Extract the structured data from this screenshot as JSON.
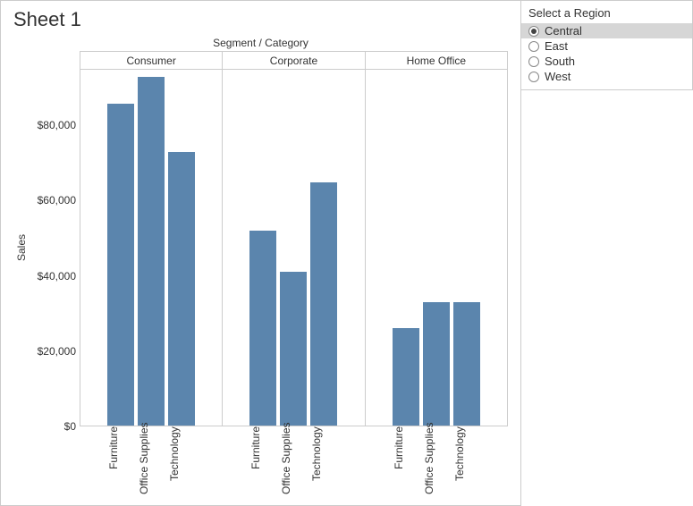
{
  "sheet_title": "Sheet 1",
  "chart_top_label": "Segment  /  Category",
  "yaxis_label": "Sales",
  "yticks": [
    "$80,000",
    "$60,000",
    "$40,000",
    "$20,000",
    "$0"
  ],
  "segments": [
    "Consumer",
    "Corporate",
    "Home Office"
  ],
  "categories": [
    "Furniture",
    "Office Supplies",
    "Technology"
  ],
  "filter": {
    "title": "Select a Region",
    "options": [
      "Central",
      "East",
      "South",
      "West"
    ],
    "selected": "Central"
  },
  "chart_data": {
    "type": "bar",
    "title": "Sheet 1",
    "facet_by": "Segment",
    "xlabel": "Category",
    "ylabel": "Sales",
    "ylim": [
      0,
      95000
    ],
    "yticks": [
      0,
      20000,
      40000,
      60000,
      80000
    ],
    "categories": [
      "Furniture",
      "Office Supplies",
      "Technology"
    ],
    "series": [
      {
        "name": "Consumer",
        "values": [
          86000,
          93000,
          73000
        ]
      },
      {
        "name": "Corporate",
        "values": [
          52000,
          41000,
          65000
        ]
      },
      {
        "name": "Home Office",
        "values": [
          26000,
          33000,
          33000
        ]
      }
    ],
    "color": "#5b85ad",
    "filter_applied": {
      "Region": "Central"
    }
  }
}
